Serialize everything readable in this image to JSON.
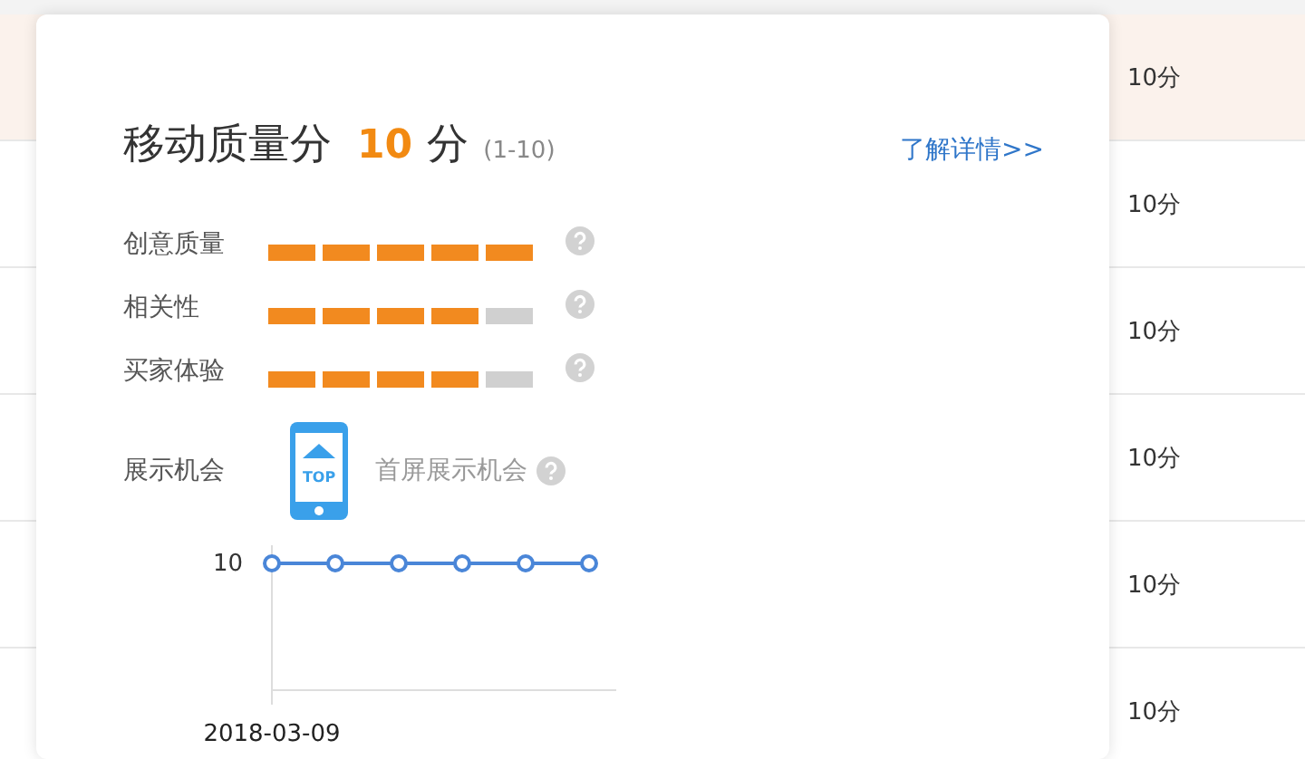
{
  "table": {
    "rows": [
      {
        "score": "10分",
        "highlighted": true
      },
      {
        "score": "10分",
        "highlighted": false
      },
      {
        "score": "10分",
        "highlighted": false
      },
      {
        "score": "10分",
        "highlighted": false
      },
      {
        "score": "10分",
        "highlighted": false
      },
      {
        "score": "10分",
        "highlighted": false
      }
    ]
  },
  "popup": {
    "title": "移动质量分",
    "score": "10",
    "unit": "分",
    "range": "(1-10)",
    "link": "了解详情>>",
    "metrics": [
      {
        "label": "创意质量",
        "stars": 5
      },
      {
        "label": "相关性",
        "stars": 4
      },
      {
        "label": "买家体验",
        "stars": 4
      }
    ],
    "exposure": {
      "label": "展示机会",
      "badge": "TOP",
      "value": "首屏展示机会"
    },
    "trend": {
      "kind": "picture",
      "y_label": "10",
      "x_label": "2018-03-09"
    }
  }
}
